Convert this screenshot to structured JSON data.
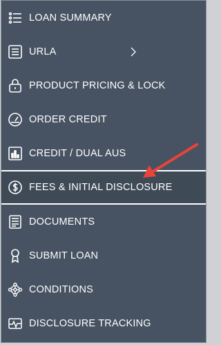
{
  "menu": {
    "items": [
      {
        "label": "LOAN SUMMARY",
        "icon": "list-icon"
      },
      {
        "label": "URLA",
        "icon": "form-icon",
        "has_submenu": true
      },
      {
        "label": "PRODUCT PRICING & LOCK",
        "icon": "lock-icon"
      },
      {
        "label": "ORDER CREDIT",
        "icon": "gauge-icon"
      },
      {
        "label": "CREDIT / DUAL AUS",
        "icon": "bar-chart-icon"
      },
      {
        "label": "FEES & INITIAL DISCLOSURE",
        "icon": "dollar-circle-icon",
        "highlighted": true
      },
      {
        "label": "DOCUMENTS",
        "icon": "document-icon"
      },
      {
        "label": "SUBMIT LOAN",
        "icon": "ribbon-award-icon"
      },
      {
        "label": "CONDITIONS",
        "icon": "network-icon"
      },
      {
        "label": "DISCLOSURE TRACKING",
        "icon": "pulse-monitor-icon"
      }
    ]
  },
  "colors": {
    "panel_bg": "#475362",
    "text": "#ffffff",
    "annotation_arrow": "#e8443a"
  }
}
